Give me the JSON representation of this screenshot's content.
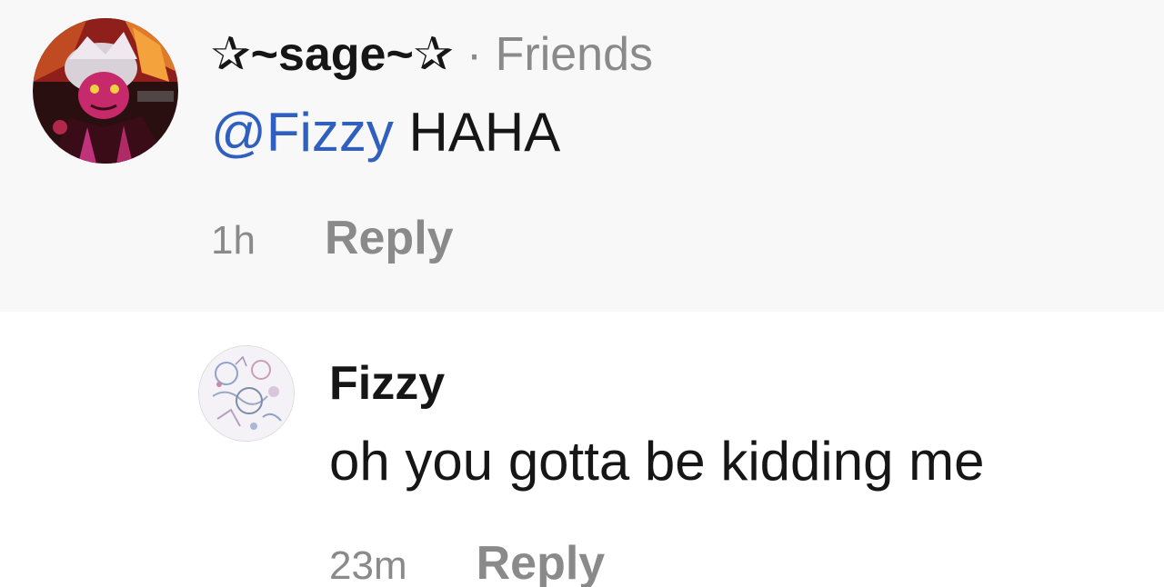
{
  "comments": [
    {
      "username": "✰~sage~✰",
      "separator": " · ",
      "relation_tag": "Friends",
      "mention": "@Fizzy",
      "text": " HAHA",
      "timestamp": "1h",
      "reply_label": "Reply",
      "avatar_icon": "anime-character-avatar"
    },
    {
      "username": "Fizzy",
      "text": "oh you gotta be kidding me",
      "timestamp": "23m",
      "reply_label": "Reply",
      "avatar_icon": "sketch-collage-avatar"
    }
  ],
  "colors": {
    "highlight_background": "#f8f8f8",
    "mention": "#2f5fbf",
    "secondary_text": "#8a8a8a",
    "primary_text": "#161616"
  }
}
